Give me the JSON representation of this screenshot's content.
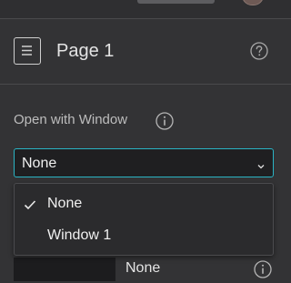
{
  "header": {
    "title": "Page 1",
    "page_icon": "page-icon",
    "help_icon": "help-circle-icon"
  },
  "window_setting": {
    "label": "Open with Window",
    "info_icon": "info-circle-icon",
    "selected": "None",
    "options": [
      {
        "label": "None",
        "selected": true
      },
      {
        "label": "Window 1",
        "selected": false
      }
    ]
  },
  "next_row": {
    "value": "None",
    "info_icon": "info-circle-icon"
  },
  "colors": {
    "panel_bg": "#333335",
    "focus_border": "#2ab4c4",
    "input_bg": "#1f1f21",
    "dropdown_bg": "#2b2b2d"
  }
}
